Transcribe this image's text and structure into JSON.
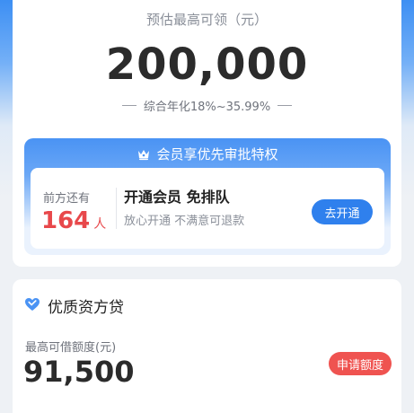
{
  "estimate": {
    "label": "预估最高可领（元）",
    "amount": "200,000",
    "rate": "综合年化18%~35.99%"
  },
  "vip": {
    "header": "会员享优先审批特权",
    "ahead_label": "前方还有",
    "ahead_count": "164",
    "ahead_unit": "人",
    "title": "开通会员 免排队",
    "subtitle": "放心开通 不满意可退款",
    "button": "去开通",
    "icon": "crown-icon"
  },
  "loan": {
    "icon": "heart-icon",
    "title": "优质资方贷",
    "max_label": "最高可借额度(元)",
    "max_amount": "91,500",
    "apply_button": "申请额度"
  },
  "colors": {
    "brand_blue": "#2f80ed",
    "accent_red": "#e8484b",
    "apply_red": "#ef5350"
  }
}
